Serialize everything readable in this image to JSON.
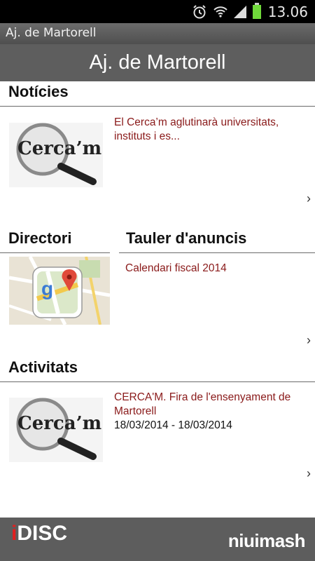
{
  "status": {
    "time": "13.06"
  },
  "app": {
    "window_title": "Aj. de Martorell",
    "header_title": "Aj. de Martorell"
  },
  "noticies": {
    "title": "Notícies",
    "item": {
      "text": "El Cerca’m aglutinarà universitats, instituts i es...",
      "thumb": "Cerca’m"
    }
  },
  "directori": {
    "title": "Directori",
    "icon": "google-maps-icon"
  },
  "tauler": {
    "title": "Tauler d'anuncis",
    "item": "Calendari fiscal 2014"
  },
  "activitats": {
    "title": "Activitats",
    "item": {
      "text": "CERCA'M. Fira de l'ensenyament de Martorell",
      "date": "18/03/2014 - 18/03/2014",
      "thumb": "Cerca’m"
    }
  },
  "footer": {
    "brand_i": "i",
    "brand_rest": "DISC",
    "right": "niuimash"
  }
}
